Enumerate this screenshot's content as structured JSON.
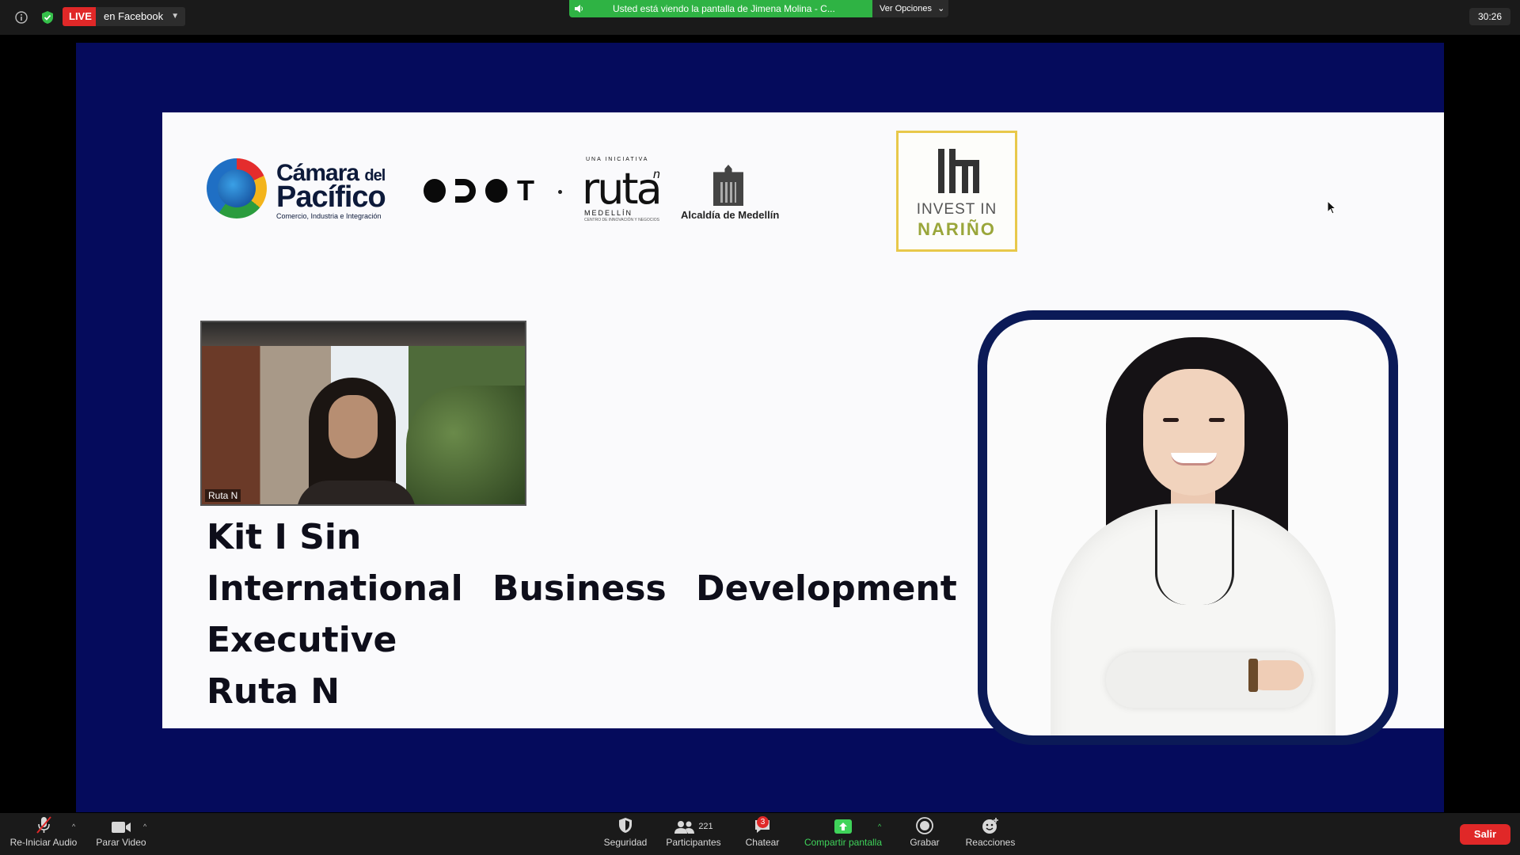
{
  "topbar": {
    "info_icon": "info-circle-icon",
    "shield_icon": "shield-check-icon",
    "live_label": "LIVE",
    "live_destination": "en Facebook",
    "share_banner": "Usted está viendo la pantalla de Jimena Molina - C...",
    "view_options": "Ver Opciones",
    "timer": "30:26"
  },
  "slide": {
    "logos": {
      "camara_line1": "Cámara",
      "camara_line1_small": "del",
      "camara_line2": "Pacífico",
      "camara_sub": "Comercio, Industria e Integración",
      "dot_text": "T",
      "ruta_pre": "UNA INICIATIVA",
      "ruta_word": "ruta",
      "ruta_n": "n",
      "ruta_city": "MEDELLÍN",
      "ruta_tag": "CENTRO DE INNOVACIÓN Y NEGOCIOS",
      "alcaldia": "Alcaldía de Medellín",
      "narino_line1": "INVEST IN",
      "narino_line2": "NARIÑO"
    },
    "video_label": "Ruta N",
    "speaker": {
      "name": "Kit I Sin",
      "title_line1": "International Business Development",
      "title_line2": "Executive",
      "org": "Ruta N"
    }
  },
  "toolbar": {
    "audio": "Re-Iniciar Audio",
    "video": "Parar Video",
    "security": "Seguridad",
    "participants": "Participantes",
    "participants_count": "221",
    "chat": "Chatear",
    "chat_badge": "3",
    "share": "Compartir pantalla",
    "record": "Grabar",
    "reactions": "Reacciones",
    "leave": "Salir"
  },
  "colors": {
    "stage_bg": "#050b5c",
    "live_red": "#e02828",
    "share_green": "#2fb344",
    "portrait_border": "#0b1a57",
    "narino_border": "#e8c84a"
  }
}
